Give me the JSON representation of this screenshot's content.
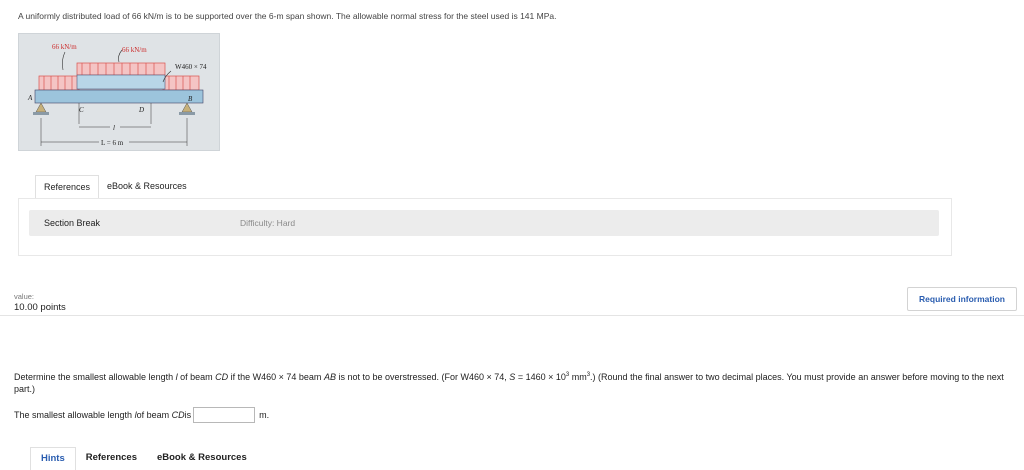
{
  "problem": {
    "intro": "A uniformly distributed load of 66 kN/m is to be supported over the 6-m span shown. The allowable normal stress for the steel used is 141 MPa."
  },
  "figure": {
    "load_left": "66 kN/m",
    "load_middle": "66 kN/m",
    "section_label": "W460 × 74",
    "point_a": "A",
    "point_b": "B",
    "point_c": "C",
    "point_d": "D",
    "dim_l": "l",
    "dim_span": "L = 6 m"
  },
  "top_tabs": {
    "references": "References",
    "ebook": "eBook & Resources"
  },
  "section_break": {
    "label": "Section Break",
    "difficulty": "Difficulty: Hard"
  },
  "value": {
    "label": "value:",
    "points": "10.00 points"
  },
  "required_info": "Required information",
  "question": {
    "part1": "Determine the smallest allowable length ",
    "l": "l",
    "part2": " of beam ",
    "cd": "CD",
    "part3": " if the W460 × 74 beam ",
    "ab": "AB",
    "part4": " is not to be overstressed. (For W460 × 74, ",
    "s": "S",
    "part5": " = 1460 × 10",
    "exp": "3",
    "part6": " mm",
    "exp2": "3",
    "part7": ".) (Round the final answer to two decimal places. You must provide an answer before moving to the next part.)"
  },
  "answer": {
    "prefix": "The smallest allowable length ",
    "l": "l",
    "middle": " of beam ",
    "cd": "CD",
    "suffix": " is",
    "value": "",
    "unit": "m."
  },
  "bottom_tabs": {
    "hints": "Hints",
    "references": "References",
    "ebook": "eBook & Resources"
  },
  "colors": {
    "load_arrows": "#d9534f",
    "beam": "#9cc4dc",
    "link": "#2a5db0"
  }
}
